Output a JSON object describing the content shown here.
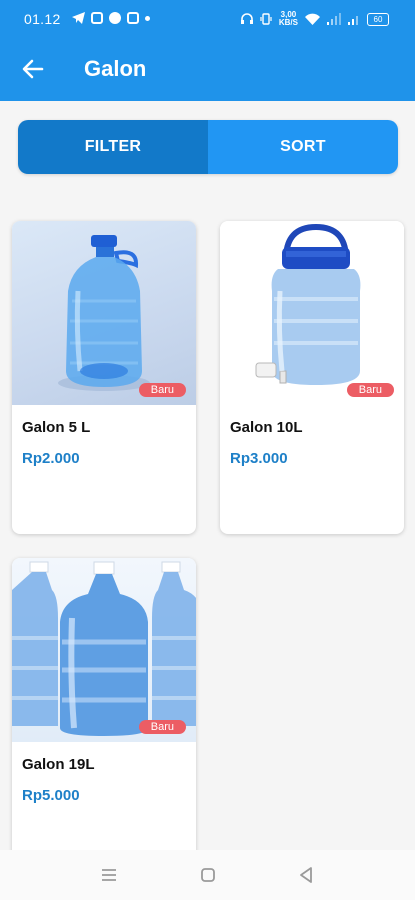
{
  "status_bar": {
    "time": "01.12",
    "network_speed_top": "3,00",
    "network_speed_unit": "KB/S",
    "battery": "60"
  },
  "appbar": {
    "title": "Galon",
    "back_icon": "arrow-left-icon"
  },
  "toolbar": {
    "filter_label": "FILTER",
    "sort_label": "SORT"
  },
  "products": [
    {
      "name": "Galon 5 L",
      "price": "Rp2.000",
      "badge": "Baru",
      "image": "water-bottle-5l-image"
    },
    {
      "name": "Galon 10L",
      "price": "Rp3.000",
      "badge": "Baru",
      "image": "water-jar-10l-image"
    },
    {
      "name": "Galon 19L",
      "price": "Rp5.000",
      "badge": "Baru",
      "image": "water-gallon-19l-image"
    }
  ],
  "colors": {
    "primary": "#1f93ea",
    "filter_bg": "#1279c9",
    "sort_bg": "#2196f3",
    "price": "#1e80c8",
    "badge": "#ec5d64"
  },
  "nav": [
    "menu-icon",
    "home-icon",
    "back-icon"
  ]
}
